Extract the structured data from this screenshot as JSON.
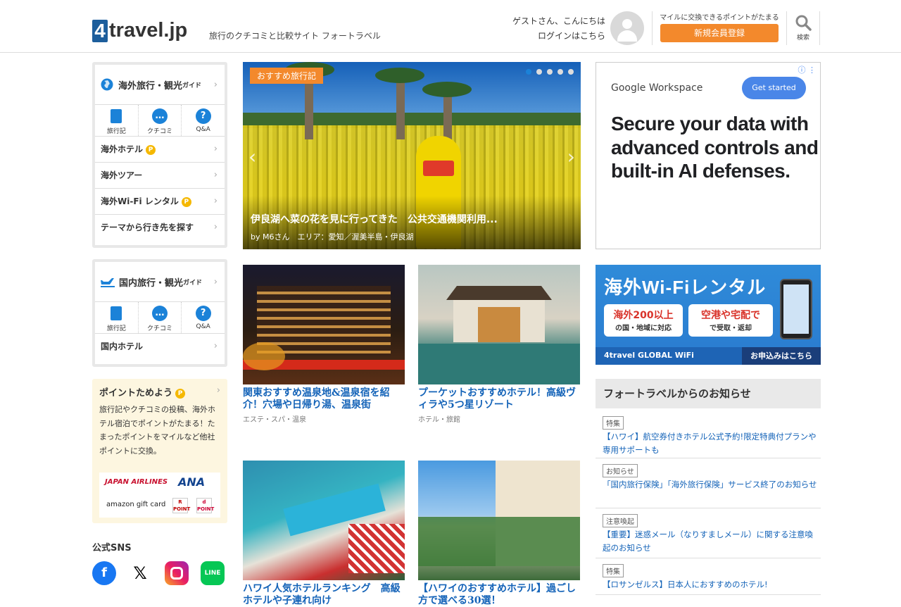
{
  "header": {
    "logo_mark": "4",
    "logo_text": "travel.jp",
    "tagline": "旅行のクチコミと比較サイト フォートラベル",
    "greeting": "ゲストさん、こんにちは",
    "login": "ログインはこちら",
    "mile_text": "マイルに交換できるポイントがたまる",
    "register": "新規会員登録",
    "search": "検索"
  },
  "overseas": {
    "title": "海外旅行・観光",
    "title_small": "ガイド",
    "icons": [
      "旅行記",
      "クチコミ",
      "Q&A"
    ],
    "rows": [
      "海外ホテル",
      "海外ツアー",
      "海外Wi-Fi レンタル",
      "テーマから行き先を探す"
    ]
  },
  "domestic": {
    "title": "国内旅行・観光",
    "title_small": "ガイド",
    "icons": [
      "旅行記",
      "クチコミ",
      "Q&A"
    ],
    "rows": [
      "国内ホテル"
    ]
  },
  "points": {
    "title": "ポイントためよう",
    "text": "旅行記やクチコミの投稿、海外ホテル宿泊でポイントがたまる！たまったポイントをマイルなど他社ポイントに交換。",
    "partners": [
      "JAPAN AIRLINES",
      "ANA",
      "amazon gift card",
      "R POINT",
      "d POINT"
    ]
  },
  "sns": {
    "title": "公式SNS",
    "items": [
      "facebook-icon",
      "x-icon",
      "instagram-icon",
      "line-icon"
    ],
    "line_label": "LINE"
  },
  "hero": {
    "badge": "おすすめ旅行記",
    "title": "伊良湖へ菜の花を見に行ってきた　公共交通機関利用...",
    "sub": "by M6さん　エリア：愛知／渥美半島・伊良湖",
    "dots": 5,
    "active_dot": 0
  },
  "cards": [
    {
      "title": "関東おすすめ温泉地&温泉宿を紹介！穴場や日帰り湯、温泉街",
      "category": "エステ・スパ・温泉"
    },
    {
      "title": "プーケットおすすめホテル！高級ヴィラや5つ星リゾート",
      "category": "ホテル・旅館"
    },
    {
      "title": "ハワイ人気ホテルランキング　高級ホテルや子連れ向け",
      "category": ""
    },
    {
      "title": "【ハワイのおすすめホテル】過ごし方で選べる30選！",
      "category": ""
    }
  ],
  "ad": {
    "brand": "Google Workspace",
    "button": "Get started",
    "headline": "Secure your data with advanced controls and built-in AI defenses."
  },
  "wifi": {
    "title": "海外Wi-Fiレンタル",
    "box1": "海外200以上",
    "box1_sub": "の国・地域に対応",
    "box2": "空港や宅配で",
    "box2_sub": "で受取・返却",
    "brand": "4travel GLOBAL WiFi",
    "apply": "お申込みはこちら"
  },
  "news": {
    "title": "フォートラベルからのお知らせ",
    "items": [
      {
        "tag": "特集",
        "text": "【ハワイ】航空券付きホテル公式予約!限定特典付プランや専用サポートも"
      },
      {
        "tag": "お知らせ",
        "text": "「国内旅行保険」「海外旅行保険」サービス終了のお知らせ"
      },
      {
        "tag": "注意喚起",
        "text": "【重要】迷惑メール（なりすましメール）に関する注意喚起のお知らせ"
      },
      {
        "tag": "特集",
        "text": "【ロサンゼルス】日本人におすすめのホテル!"
      }
    ]
  }
}
